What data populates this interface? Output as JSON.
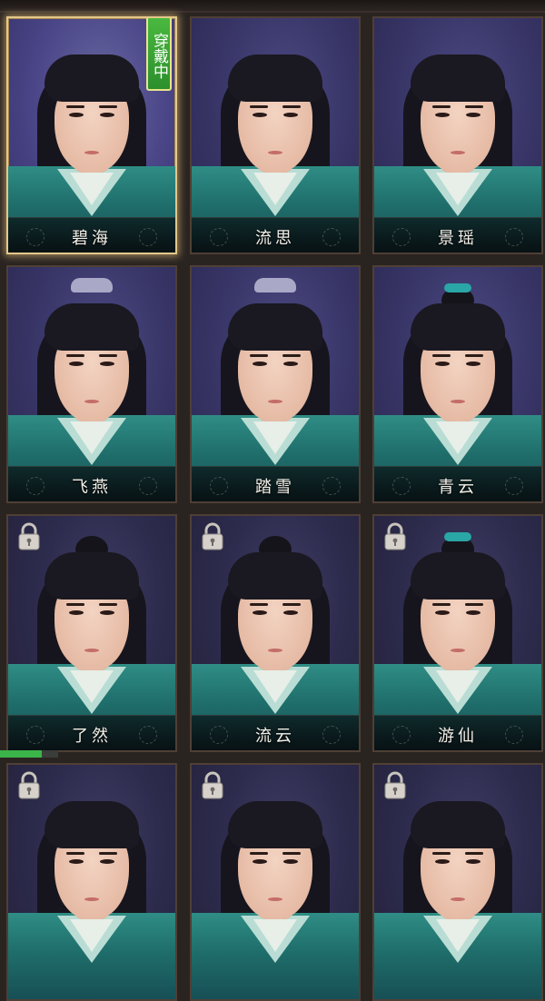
{
  "top_bar": {},
  "wearing_tag_label": "穿戴中",
  "progress_fraction": 0.72,
  "cards": [
    {
      "name": "碧海",
      "selected": true,
      "locked": false,
      "style": "short"
    },
    {
      "name": "流思",
      "selected": false,
      "locked": false,
      "style": "short"
    },
    {
      "name": "景瑶",
      "selected": false,
      "locked": false,
      "style": "short"
    },
    {
      "name": "飞燕",
      "selected": false,
      "locked": false,
      "style": "crown"
    },
    {
      "name": "踏雪",
      "selected": false,
      "locked": false,
      "style": "crown"
    },
    {
      "name": "青云",
      "selected": false,
      "locked": false,
      "style": "band"
    },
    {
      "name": "了然",
      "selected": false,
      "locked": true,
      "style": "knot"
    },
    {
      "name": "流云",
      "selected": false,
      "locked": true,
      "style": "knot"
    },
    {
      "name": "游仙",
      "selected": false,
      "locked": true,
      "style": "band"
    },
    {
      "name": "",
      "selected": false,
      "locked": true,
      "style": "short"
    },
    {
      "name": "",
      "selected": false,
      "locked": true,
      "style": "short"
    },
    {
      "name": "",
      "selected": false,
      "locked": true,
      "style": "short"
    }
  ],
  "colors": {
    "selected_border": "#e4c889",
    "tag_green": "#3aa63a",
    "robe_teal": "#1f6e6b"
  },
  "icons": {
    "lock": "lock-icon"
  }
}
